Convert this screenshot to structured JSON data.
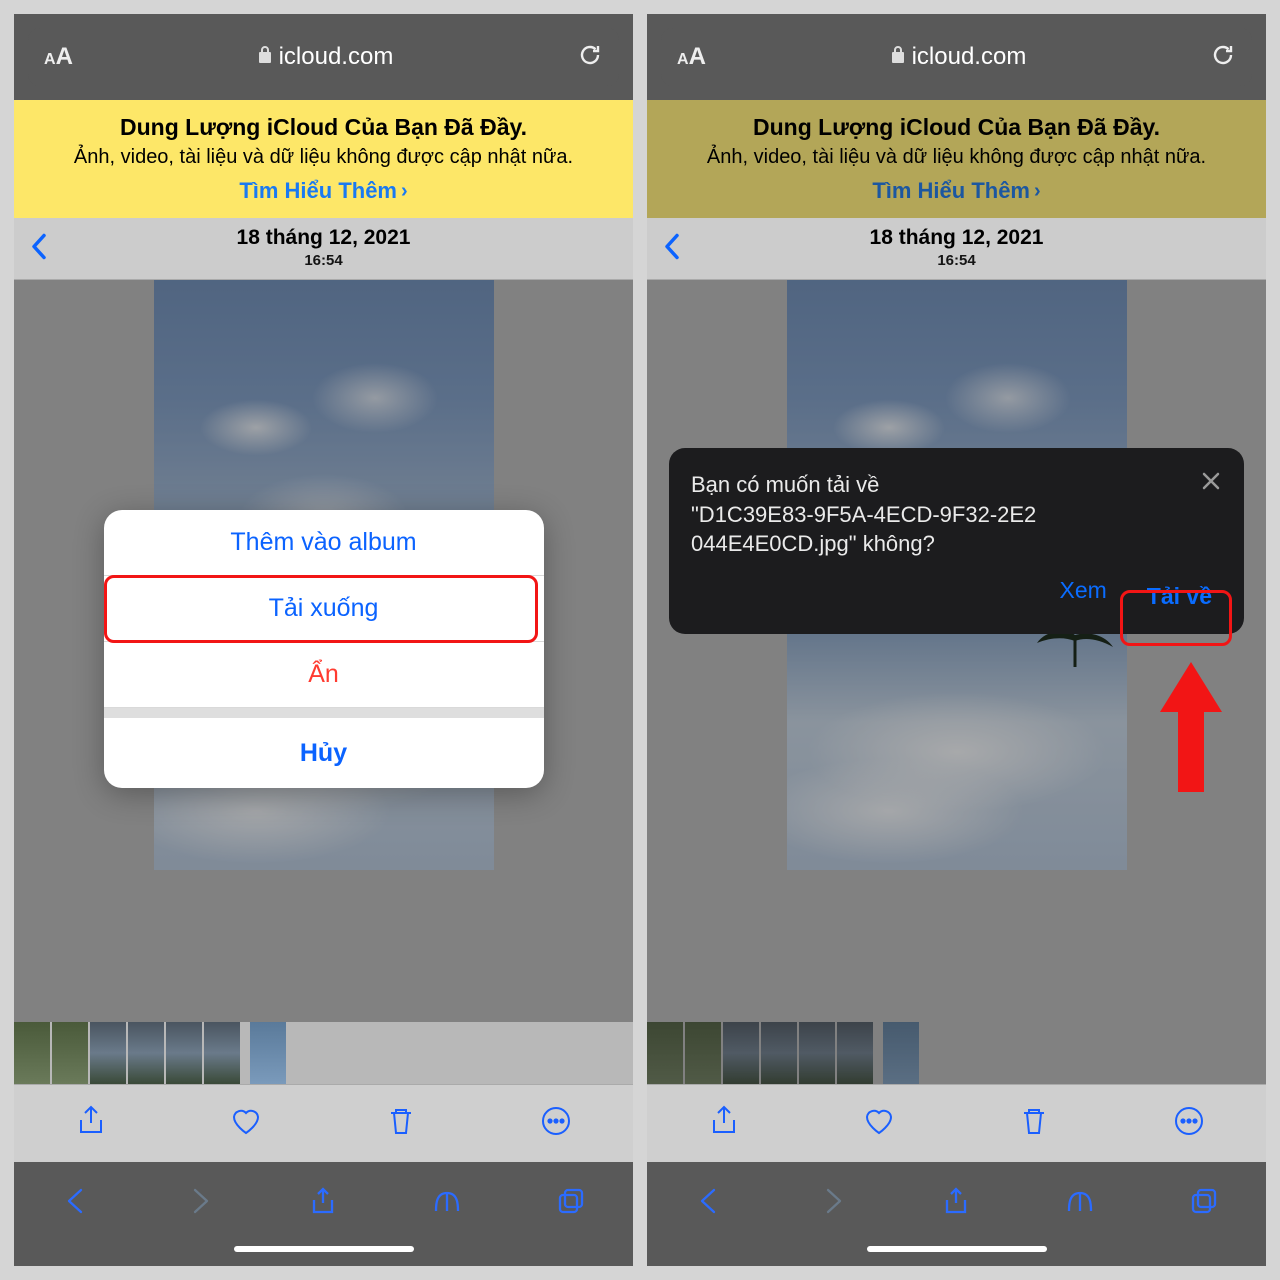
{
  "addressbar": {
    "aa_small": "A",
    "aa_big": "A",
    "domain": "icloud.com"
  },
  "banner": {
    "title": "Dung Lượng iCloud Của Bạn Đã Đầy.",
    "subtitle": "Ảnh, video, tài liệu và dữ liệu không được cập nhật nữa.",
    "link": "Tìm Hiểu Thêm"
  },
  "datebar": {
    "date": "18 tháng 12, 2021",
    "time": "16:54"
  },
  "action_sheet": {
    "add_to_album": "Thêm vào album",
    "download": "Tải xuống",
    "hide": "Ẩn",
    "cancel": "Hủy"
  },
  "download_prompt": {
    "line1": "Bạn có muốn tải về",
    "line2": "\"D1C39E83-9F5A-4ECD-9F32-2E2",
    "line3": "044E4E0CD.jpg\" không?",
    "view": "Xem",
    "download": "Tải về"
  }
}
